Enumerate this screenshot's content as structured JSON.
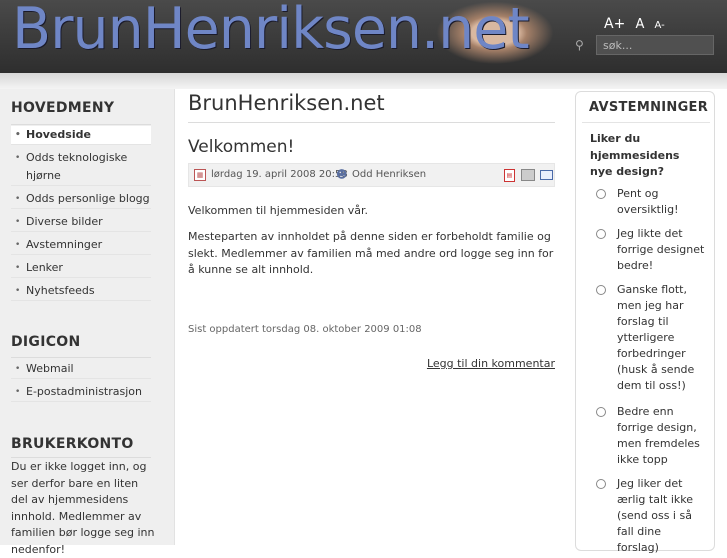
{
  "header": {
    "logo_text": "BrunHenriksen.net",
    "font_size_controls": [
      "A+",
      "A",
      "A-"
    ],
    "search_placeholder": "søk..."
  },
  "left": {
    "main_menu_title": "HOVEDMENY",
    "main_menu": [
      {
        "label": "Hovedside",
        "active": true
      },
      {
        "label": "Odds teknologiske hjørne"
      },
      {
        "label": "Odds personlige blogg"
      },
      {
        "label": "Diverse bilder"
      },
      {
        "label": "Avstemninger"
      },
      {
        "label": "Lenker"
      },
      {
        "label": "Nyhetsfeeds"
      }
    ],
    "digicon_title": "DIGICON",
    "digicon_menu": [
      {
        "label": "Webmail"
      },
      {
        "label": "E-postadministrasjon"
      }
    ],
    "account_title": "BRUKERKONTO",
    "account_text": "Du er ikke logget inn, og ser derfor bare en liten del av hjemmesidens innhold. Medlemmer av familien bør logge seg inn nedenfor!"
  },
  "main": {
    "site_title": "BrunHenriksen.net",
    "article_title": "Velkommen!",
    "date": "lørdag 19. april 2008 20:58",
    "author": "Odd Henriksen",
    "paragraph1": "Velkommen til hjemmesiden vår.",
    "paragraph2": "Mesteparten av innholdet på denne siden er forbeholdt familie og slekt. Medlemmer av familien må med andre ord logge seg inn for å kunne se alt innhold.",
    "updated": "Sist oppdatert torsdag 08. oktober 2009 01:08",
    "comment_link": "Legg til din kommentar"
  },
  "poll": {
    "title": "AVSTEMNINGER",
    "question": "Liker du hjemmesidens nye design?",
    "options": [
      "Pent og oversiktlig!",
      "Jeg likte det forrige designet bedre!",
      "Ganske flott, men jeg har forslag til ytterligere forbedringer (husk å sende dem til oss!)",
      "Bedre enn forrige design, men fremdeles ikke topp",
      "Jeg liker det ærlig talt ikke (send oss i så fall dine forslag)"
    ]
  },
  "icons": {
    "calendar": "calendar-icon",
    "author": "user-icon",
    "pdf": "pdf-icon",
    "print": "print-icon",
    "email": "email-icon",
    "search": "search-icon"
  }
}
